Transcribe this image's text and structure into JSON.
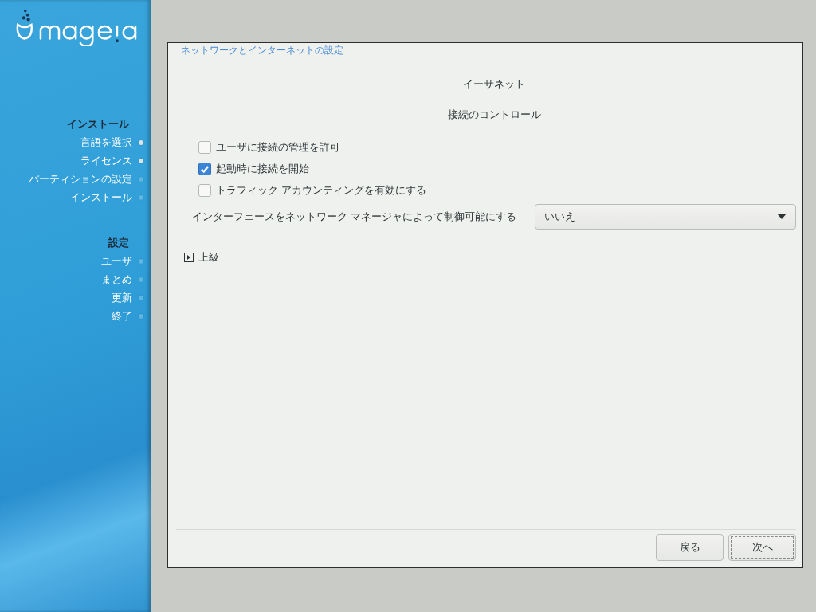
{
  "sidebar": {
    "sections": [
      {
        "title": "インストール",
        "steps": [
          {
            "label": "言語を選択",
            "done": true
          },
          {
            "label": "ライセンス",
            "done": true
          },
          {
            "label": "パーティションの設定",
            "done": false
          },
          {
            "label": "インストール",
            "done": false
          }
        ]
      },
      {
        "title": "設定",
        "steps": [
          {
            "label": "ユーザ",
            "done": false
          },
          {
            "label": "まとめ",
            "done": false
          },
          {
            "label": "更新",
            "done": false
          },
          {
            "label": "終了",
            "done": false
          }
        ]
      }
    ]
  },
  "dialog": {
    "title": "ネットワークとインターネットの設定",
    "headings": [
      "イーサネット",
      "接続のコントロール"
    ],
    "checkboxes": [
      {
        "label": "ユーザに接続の管理を許可",
        "checked": false
      },
      {
        "label": "起動時に接続を開始",
        "checked": true
      },
      {
        "label": "トラフィック アカウンティングを有効にする",
        "checked": false
      }
    ],
    "combo": {
      "label": "インターフェースをネットワーク マネージャによって制御可能にする",
      "value": "いいえ"
    },
    "expander": {
      "label": "上級",
      "expanded": false
    },
    "buttons": [
      {
        "label": "戻る",
        "focused": false
      },
      {
        "label": "次へ",
        "focused": true
      }
    ]
  }
}
